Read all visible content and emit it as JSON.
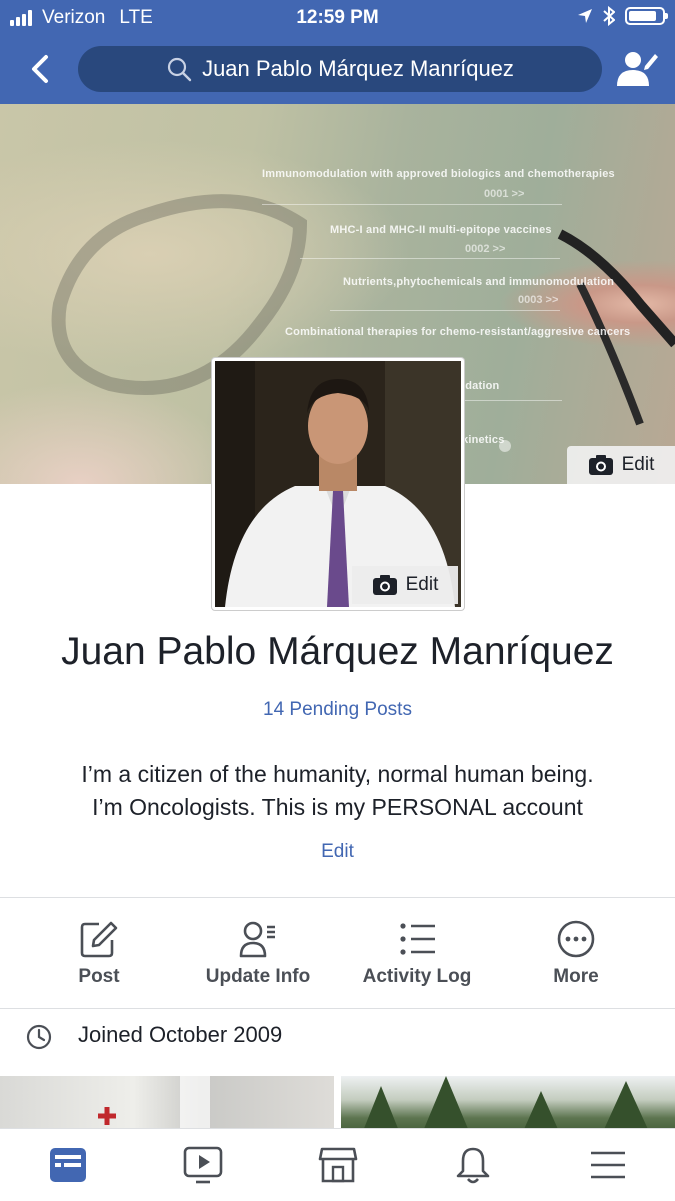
{
  "status_bar": {
    "carrier": "Verizon",
    "network": "LTE",
    "time": "12:59 PM",
    "battery_level": 0.85
  },
  "nav": {
    "search_text": "Juan Pablo Márquez Manríquez",
    "icons": [
      "back-chevron-icon",
      "search-icon",
      "friend-settings-icon"
    ]
  },
  "cover": {
    "lines": [
      "Immunomodulation with approved biologics and chemotherapies",
      "MHC-I and MHC-II multi-epitope vaccines",
      "Nutrients,phytochemicals and immunomodulation",
      "Combinational therapies for chemo-resistant/aggresive cancers",
      "idation",
      "kinetics"
    ],
    "codes": [
      "0001 >>",
      "0002 >>",
      "0003 >>"
    ],
    "edit_label": "Edit"
  },
  "avatar": {
    "edit_label": "Edit"
  },
  "profile": {
    "name": "Juan Pablo Márquez Manríquez",
    "pending_posts": "14 Pending Posts",
    "bio_line1": "I’m a citizen of the humanity, normal human being.",
    "bio_line2": "I’m  Oncologists. This is my PERSONAL account",
    "bio_edit": "Edit"
  },
  "actions": [
    {
      "label": "Post",
      "icon": "compose-icon"
    },
    {
      "label": "Update Info",
      "icon": "person-info-icon"
    },
    {
      "label": "Activity Log",
      "icon": "list-icon"
    },
    {
      "label": "More",
      "icon": "more-icon"
    }
  ],
  "intro": {
    "joined": "Joined October 2009",
    "icon": "clock-icon"
  },
  "tabbar": [
    "news-feed-icon",
    "watch-icon",
    "marketplace-icon",
    "notifications-icon",
    "menu-icon"
  ],
  "colors": {
    "brand": "#4267b2",
    "nav_dark": "#29487d",
    "text": "#1d2129",
    "muted": "#4b4f56"
  }
}
